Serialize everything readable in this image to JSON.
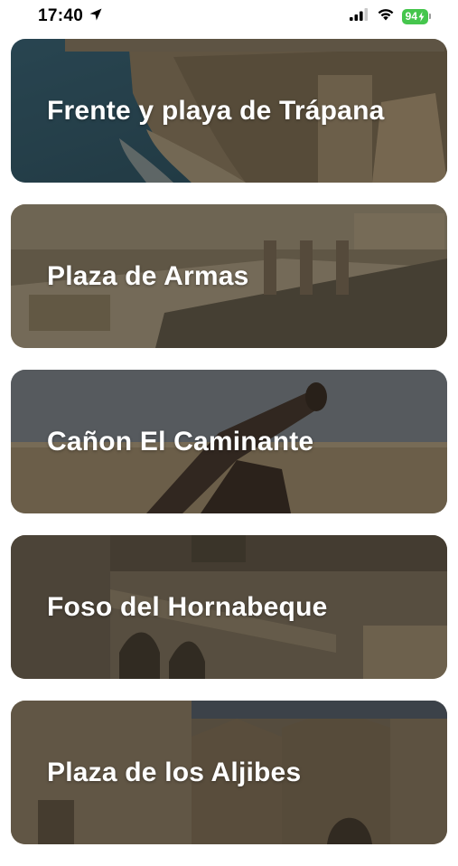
{
  "status_bar": {
    "time": "17:40",
    "battery_level": "94",
    "icons": [
      "location-arrow-icon",
      "cellular-signal-icon",
      "wifi-icon",
      "battery-charging-icon"
    ]
  },
  "places": [
    {
      "title": "Frente y playa de Trápana"
    },
    {
      "title": "Plaza de Armas"
    },
    {
      "title": "Cañon El Caminante"
    },
    {
      "title": "Foso del Hornabeque"
    },
    {
      "title": "Plaza de los Aljibes"
    }
  ],
  "colors": {
    "battery": "#45c64d",
    "card_overlay": "rgba(20,18,15,0.45)",
    "card_text": "#ffffff"
  }
}
